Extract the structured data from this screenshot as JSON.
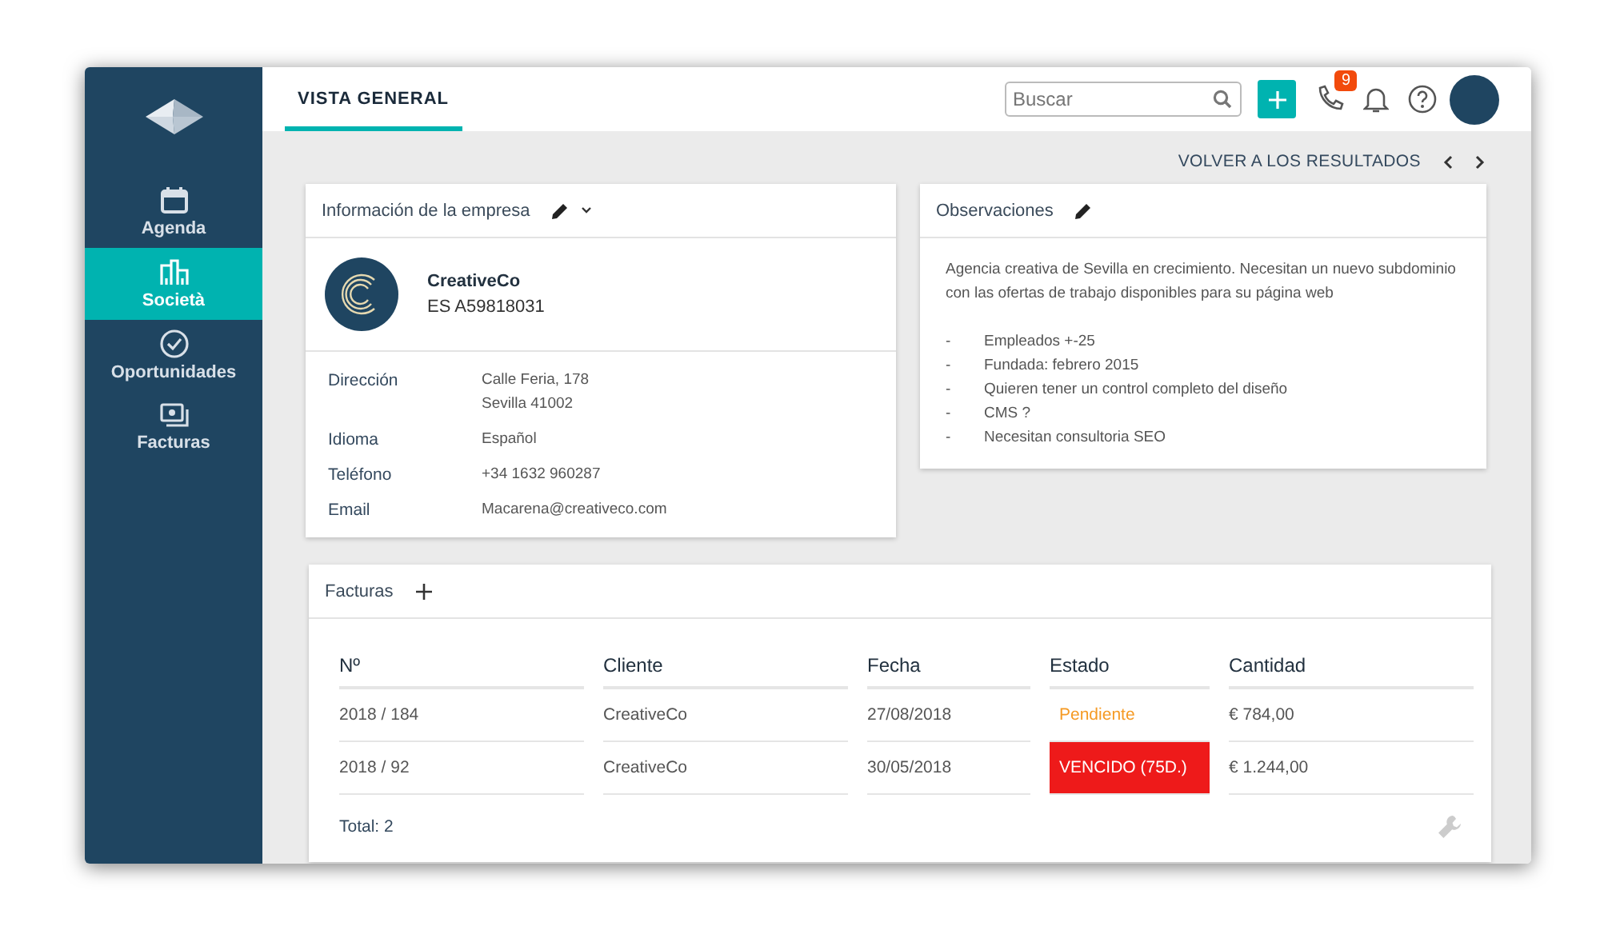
{
  "sidebar": {
    "items": [
      {
        "label": "Agenda",
        "kind": "calendar",
        "selected": false
      },
      {
        "label": "Società",
        "kind": "buildings",
        "selected": true
      },
      {
        "label": "Oportunidades",
        "kind": "check",
        "selected": false
      },
      {
        "label": "Facturas",
        "kind": "bill",
        "selected": false
      }
    ]
  },
  "topbar": {
    "tabs": [
      {
        "label": "VISTA GENERAL",
        "selected": true
      }
    ],
    "search": {
      "placeholder": "Buscar"
    },
    "calls_badge": "9"
  },
  "back_link": "VOLVER A LOS RESULTADOS",
  "company_card": {
    "title": "Información de la empresa",
    "name": "CreativeCo",
    "tax_id": "ES A59818031",
    "fields": [
      {
        "label": "Dirección",
        "lines": [
          "Calle Feria, 178",
          "Sevilla 41002"
        ]
      },
      {
        "label": "Idioma",
        "lines": [
          "Español"
        ]
      },
      {
        "label": "Teléfono",
        "lines": [
          "+34 1632 960287"
        ]
      },
      {
        "label": "Email",
        "lines": [
          "Macarena@creativeco.com"
        ]
      }
    ]
  },
  "notes_card": {
    "title": "Observaciones",
    "text": "Agencia creativa de Sevilla en crecimiento. Necesitan un nuevo subdominio con las ofertas de trabajo disponibles para su página web",
    "bullets": [
      {
        "mark": "-",
        "text": "Empleados +-25"
      },
      {
        "mark": "-",
        "text": "Fundada: febrero 2015"
      },
      {
        "mark": "-",
        "text": "Quieren tener un control completo del diseño"
      },
      {
        "mark": "-",
        "text": "CMS ?"
      },
      {
        "mark": "-",
        "text": "Necesitan consultoria SEO"
      }
    ]
  },
  "invoices": {
    "title": "Facturas",
    "columns": [
      "Nº",
      "Cliente",
      "Fecha",
      "Estado",
      "Cantidad"
    ],
    "rows": [
      {
        "number": "2018 / 184",
        "client": "CreativeCo",
        "date": "27/08/2018",
        "status": {
          "label": "Pendiente",
          "kind": "pending"
        },
        "amount": "€ 784,00"
      },
      {
        "number": "2018 / 92",
        "client": "CreativeCo",
        "date": "30/05/2018",
        "status": {
          "label": "VENCIDO (75D.)",
          "kind": "overdue"
        },
        "amount": "€ 1.244,00"
      }
    ],
    "total": "Total: 2"
  }
}
